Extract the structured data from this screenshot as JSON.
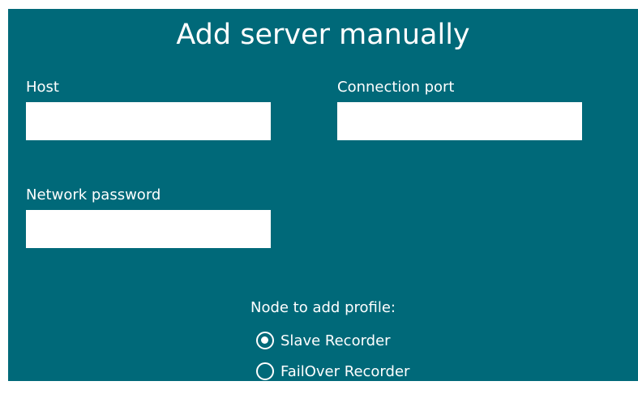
{
  "dialog": {
    "title": "Add server manually",
    "background_color": "#006979"
  },
  "fields": {
    "host": {
      "label": "Host",
      "value": ""
    },
    "port": {
      "label": "Connection port",
      "value": ""
    },
    "password": {
      "label": "Network password",
      "value": ""
    }
  },
  "profile": {
    "label": "Node to add profile:",
    "options": [
      {
        "label": "Slave Recorder",
        "checked": true
      },
      {
        "label": "FailOver Recorder",
        "checked": false
      }
    ]
  }
}
